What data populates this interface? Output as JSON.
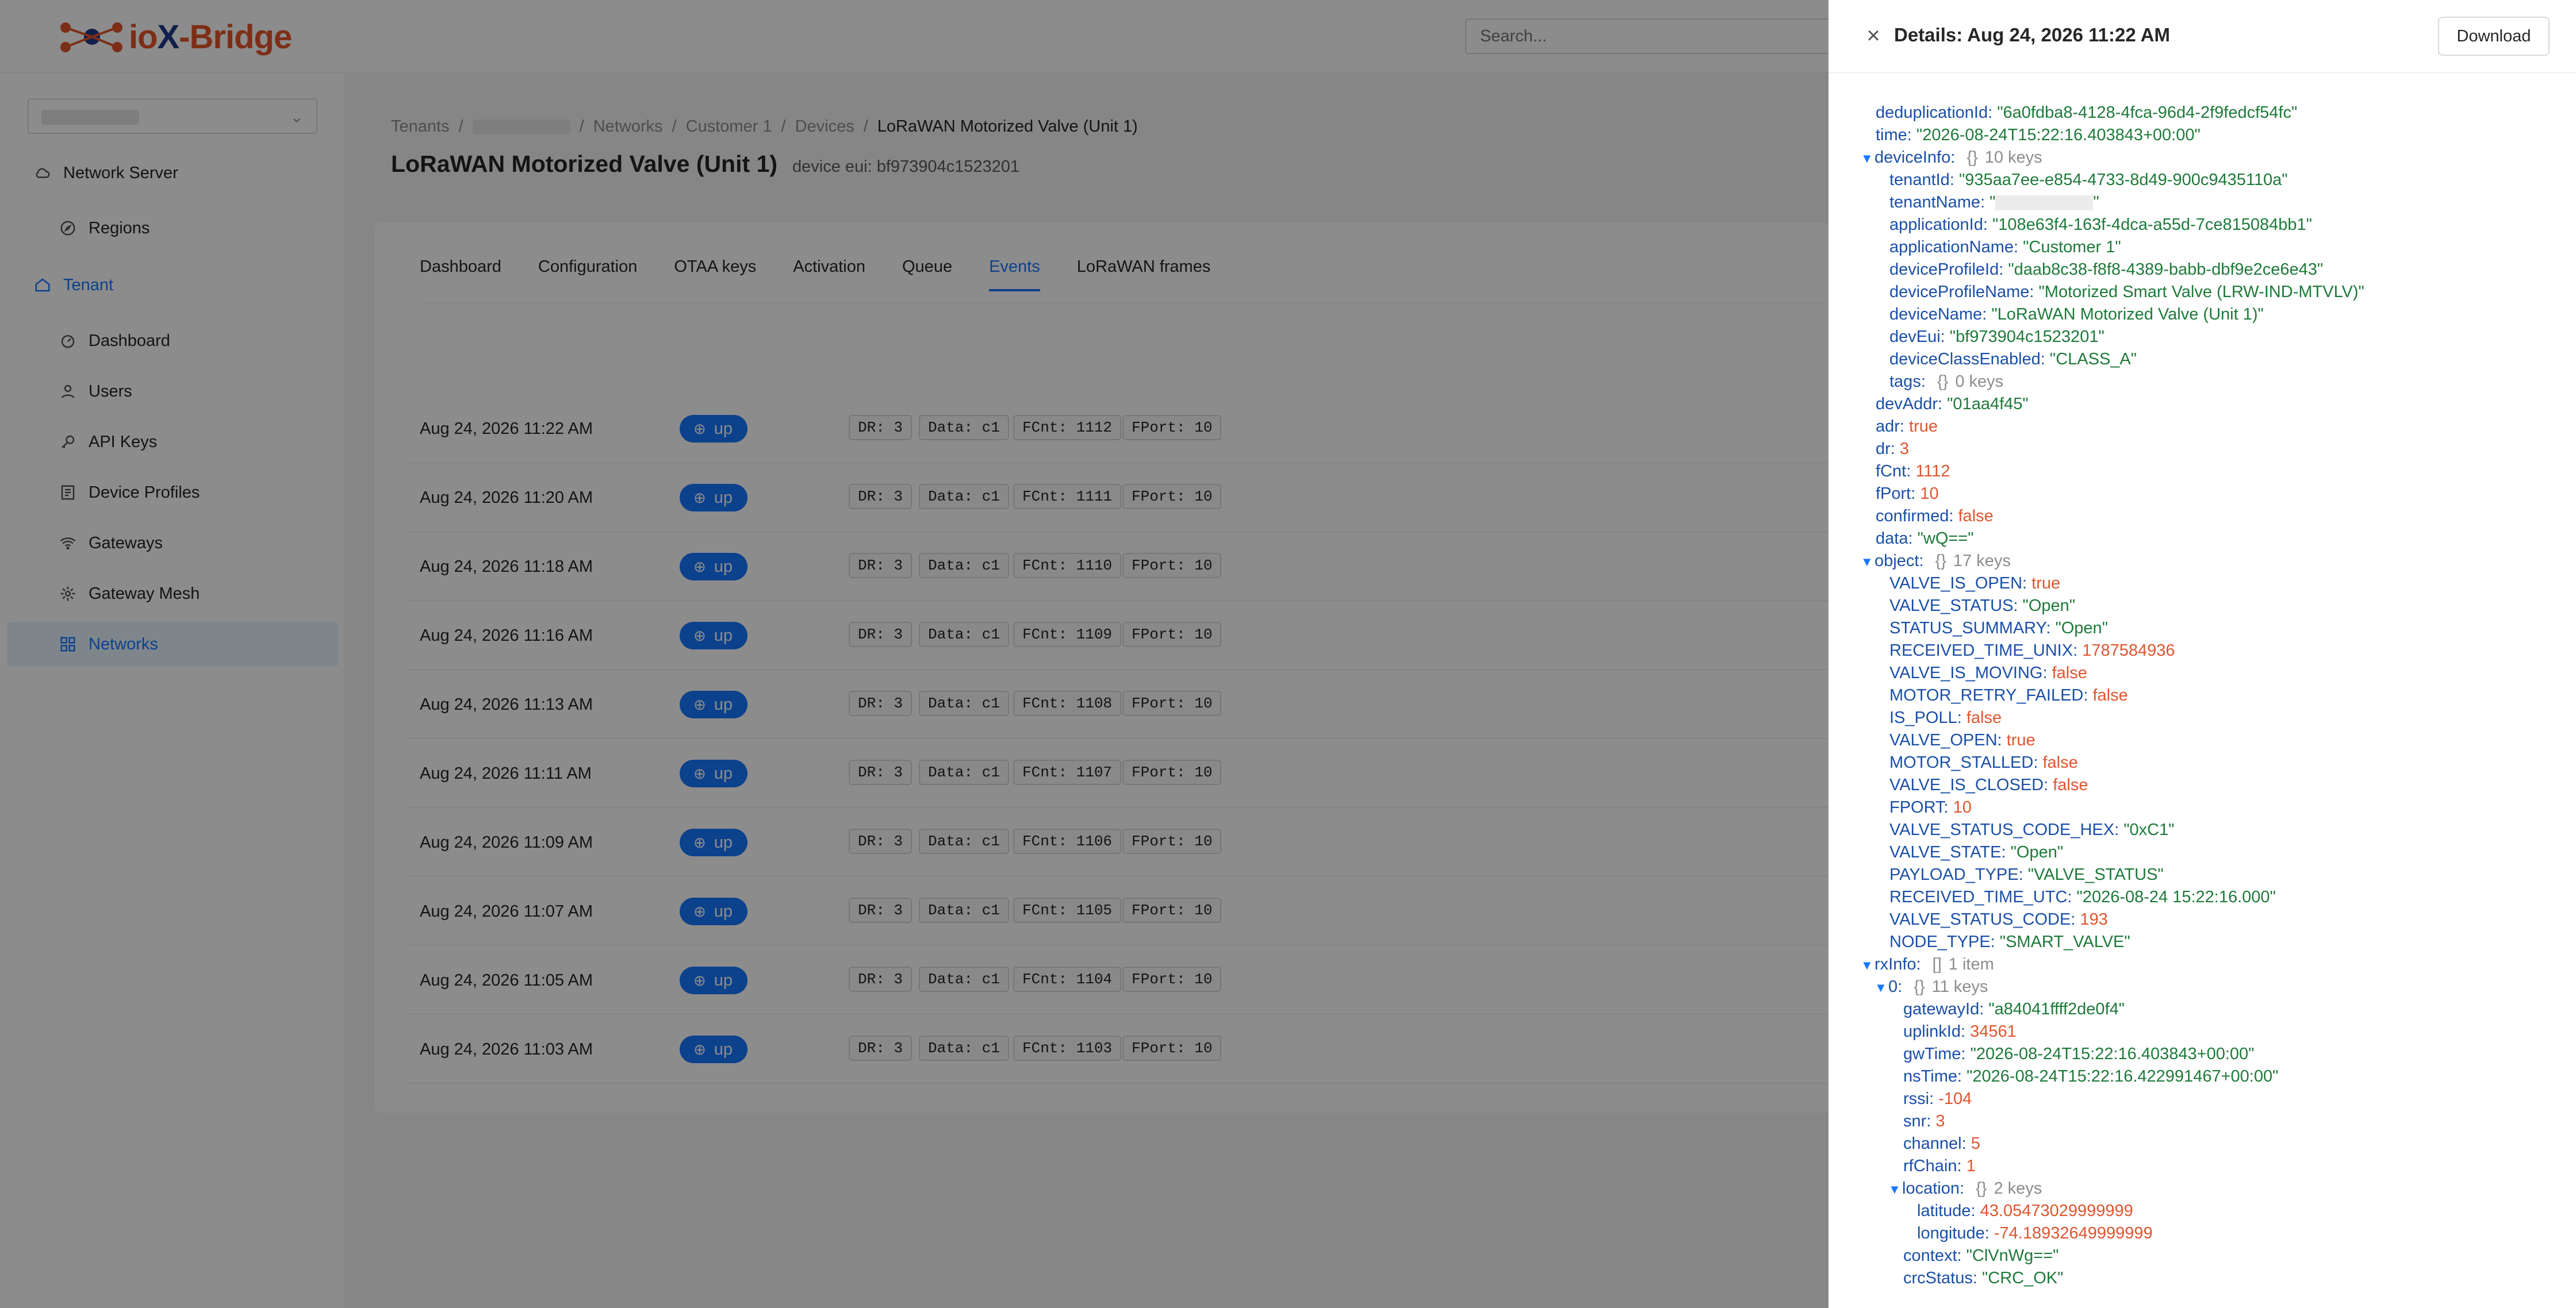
{
  "app": {
    "logo_prefix": "io",
    "logo_x": "X",
    "logo_suffix": "-Bridge",
    "search_placeholder": "Search..."
  },
  "sidebar": {
    "items": [
      {
        "label": "Network Server",
        "icon": "cloud-icon",
        "level": "top"
      },
      {
        "label": "Regions",
        "icon": "compass-icon",
        "level": "sub"
      },
      {
        "label": "Tenant",
        "icon": "home-icon",
        "level": "tenant"
      },
      {
        "label": "Dashboard",
        "icon": "dashboard-icon",
        "level": "sub"
      },
      {
        "label": "Users",
        "icon": "user-icon",
        "level": "sub"
      },
      {
        "label": "API Keys",
        "icon": "key-icon",
        "level": "sub"
      },
      {
        "label": "Device Profiles",
        "icon": "profile-icon",
        "level": "sub"
      },
      {
        "label": "Gateways",
        "icon": "wifi-icon",
        "level": "sub"
      },
      {
        "label": "Gateway Mesh",
        "icon": "mesh-icon",
        "level": "sub"
      },
      {
        "label": "Networks",
        "icon": "grid-icon",
        "level": "sub",
        "active": true
      }
    ]
  },
  "breadcrumb": {
    "tenants": "Tenants",
    "networks": "Networks",
    "customer": "Customer 1",
    "devices": "Devices",
    "current": "LoRaWAN Motorized Valve (Unit 1)"
  },
  "page": {
    "title": "LoRaWAN Motorized Valve (Unit 1)",
    "device_eui": "device eui: bf973904c1523201"
  },
  "tabs": [
    "Dashboard",
    "Configuration",
    "OTAA keys",
    "Activation",
    "Queue",
    "Events",
    "LoRaWAN frames"
  ],
  "active_tab": "Events",
  "events": [
    {
      "time": "Aug 24, 2026 11:22 AM",
      "type": "up",
      "dr": "DR: 3",
      "data": "Data: c1",
      "fcnt": "FCnt: 1112",
      "fport": "FPort: 10"
    },
    {
      "time": "Aug 24, 2026 11:20 AM",
      "type": "up",
      "dr": "DR: 3",
      "data": "Data: c1",
      "fcnt": "FCnt: 1111",
      "fport": "FPort: 10"
    },
    {
      "time": "Aug 24, 2026 11:18 AM",
      "type": "up",
      "dr": "DR: 3",
      "data": "Data: c1",
      "fcnt": "FCnt: 1110",
      "fport": "FPort: 10"
    },
    {
      "time": "Aug 24, 2026 11:16 AM",
      "type": "up",
      "dr": "DR: 3",
      "data": "Data: c1",
      "fcnt": "FCnt: 1109",
      "fport": "FPort: 10"
    },
    {
      "time": "Aug 24, 2026 11:13 AM",
      "type": "up",
      "dr": "DR: 3",
      "data": "Data: c1",
      "fcnt": "FCnt: 1108",
      "fport": "FPort: 10"
    },
    {
      "time": "Aug 24, 2026 11:11 AM",
      "type": "up",
      "dr": "DR: 3",
      "data": "Data: c1",
      "fcnt": "FCnt: 1107",
      "fport": "FPort: 10"
    },
    {
      "time": "Aug 24, 2026 11:09 AM",
      "type": "up",
      "dr": "DR: 3",
      "data": "Data: c1",
      "fcnt": "FCnt: 1106",
      "fport": "FPort: 10"
    },
    {
      "time": "Aug 24, 2026 11:07 AM",
      "type": "up",
      "dr": "DR: 3",
      "data": "Data: c1",
      "fcnt": "FCnt: 1105",
      "fport": "FPort: 10"
    },
    {
      "time": "Aug 24, 2026 11:05 AM",
      "type": "up",
      "dr": "DR: 3",
      "data": "Data: c1",
      "fcnt": "FCnt: 1104",
      "fport": "FPort: 10"
    },
    {
      "time": "Aug 24, 2026 11:03 AM",
      "type": "up",
      "dr": "DR: 3",
      "data": "Data: c1",
      "fcnt": "FCnt: 1103",
      "fport": "FPort: 10"
    }
  ],
  "drawer": {
    "title": "Details: Aug 24, 2026 11:22 AM",
    "download_label": "Download",
    "lines": [
      {
        "d": 0,
        "k": "deduplicationId",
        "v": "\"6a0fdba8-4128-4fca-96d4-2f9fedcf54fc\"",
        "t": "s"
      },
      {
        "d": 0,
        "k": "time",
        "v": "\"2026-08-24T15:22:16.403843+00:00\"",
        "t": "s"
      },
      {
        "d": 0,
        "k": "deviceInfo",
        "v": "{}",
        "t": "m",
        "meta": "10 keys",
        "tri": true
      },
      {
        "d": 1,
        "k": "tenantId",
        "v": "\"935aa7ee-e854-4733-8d49-900c9435110a\"",
        "t": "s"
      },
      {
        "d": 1,
        "k": "tenantName",
        "v": "\"\"",
        "t": "redact"
      },
      {
        "d": 1,
        "k": "applicationId",
        "v": "\"108e63f4-163f-4dca-a55d-7ce815084bb1\"",
        "t": "s"
      },
      {
        "d": 1,
        "k": "applicationName",
        "v": "\"Customer 1\"",
        "t": "s"
      },
      {
        "d": 1,
        "k": "deviceProfileId",
        "v": "\"daab8c38-f8f8-4389-babb-dbf9e2ce6e43\"",
        "t": "s"
      },
      {
        "d": 1,
        "k": "deviceProfileName",
        "v": "\"Motorized Smart Valve (LRW-IND-MTVLV)\"",
        "t": "s"
      },
      {
        "d": 1,
        "k": "deviceName",
        "v": "\"LoRaWAN Motorized Valve (Unit 1)\"",
        "t": "s"
      },
      {
        "d": 1,
        "k": "devEui",
        "v": "\"bf973904c1523201\"",
        "t": "s"
      },
      {
        "d": 1,
        "k": "deviceClassEnabled",
        "v": "\"CLASS_A\"",
        "t": "s"
      },
      {
        "d": 1,
        "k": "tags",
        "v": "{}",
        "t": "m",
        "meta": "0 keys"
      },
      {
        "d": 0,
        "k": "devAddr",
        "v": "\"01aa4f45\"",
        "t": "s"
      },
      {
        "d": 0,
        "k": "adr",
        "v": "true",
        "t": "b"
      },
      {
        "d": 0,
        "k": "dr",
        "v": "3",
        "t": "n"
      },
      {
        "d": 0,
        "k": "fCnt",
        "v": "1112",
        "t": "n"
      },
      {
        "d": 0,
        "k": "fPort",
        "v": "10",
        "t": "n"
      },
      {
        "d": 0,
        "k": "confirmed",
        "v": "false",
        "t": "b"
      },
      {
        "d": 0,
        "k": "data",
        "v": "\"wQ==\"",
        "t": "s"
      },
      {
        "d": 0,
        "k": "object",
        "v": "{}",
        "t": "m",
        "meta": "17 keys",
        "tri": true
      },
      {
        "d": 1,
        "k": "VALVE_IS_OPEN",
        "v": "true",
        "t": "b"
      },
      {
        "d": 1,
        "k": "VALVE_STATUS",
        "v": "\"Open\"",
        "t": "s"
      },
      {
        "d": 1,
        "k": "STATUS_SUMMARY",
        "v": "\"Open\"",
        "t": "s"
      },
      {
        "d": 1,
        "k": "RECEIVED_TIME_UNIX",
        "v": "1787584936",
        "t": "n"
      },
      {
        "d": 1,
        "k": "VALVE_IS_MOVING",
        "v": "false",
        "t": "b"
      },
      {
        "d": 1,
        "k": "MOTOR_RETRY_FAILED",
        "v": "false",
        "t": "b"
      },
      {
        "d": 1,
        "k": "IS_POLL",
        "v": "false",
        "t": "b"
      },
      {
        "d": 1,
        "k": "VALVE_OPEN",
        "v": "true",
        "t": "b"
      },
      {
        "d": 1,
        "k": "MOTOR_STALLED",
        "v": "false",
        "t": "b"
      },
      {
        "d": 1,
        "k": "VALVE_IS_CLOSED",
        "v": "false",
        "t": "b"
      },
      {
        "d": 1,
        "k": "FPORT",
        "v": "10",
        "t": "n"
      },
      {
        "d": 1,
        "k": "VALVE_STATUS_CODE_HEX",
        "v": "\"0xC1\"",
        "t": "s"
      },
      {
        "d": 1,
        "k": "VALVE_STATE",
        "v": "\"Open\"",
        "t": "s"
      },
      {
        "d": 1,
        "k": "PAYLOAD_TYPE",
        "v": "\"VALVE_STATUS\"",
        "t": "s"
      },
      {
        "d": 1,
        "k": "RECEIVED_TIME_UTC",
        "v": "\"2026-08-24 15:22:16.000\"",
        "t": "s"
      },
      {
        "d": 1,
        "k": "VALVE_STATUS_CODE",
        "v": "193",
        "t": "n"
      },
      {
        "d": 1,
        "k": "NODE_TYPE",
        "v": "\"SMART_VALVE\"",
        "t": "s"
      },
      {
        "d": 0,
        "k": "rxInfo",
        "v": "[]",
        "t": "m",
        "meta": "1 item",
        "tri": true
      },
      {
        "d": 1,
        "k": "0",
        "v": "{}",
        "t": "m",
        "meta": "11 keys",
        "tri": true
      },
      {
        "d": 2,
        "k": "gatewayId",
        "v": "\"a84041ffff2de0f4\"",
        "t": "s"
      },
      {
        "d": 2,
        "k": "uplinkId",
        "v": "34561",
        "t": "n"
      },
      {
        "d": 2,
        "k": "gwTime",
        "v": "\"2026-08-24T15:22:16.403843+00:00\"",
        "t": "s"
      },
      {
        "d": 2,
        "k": "nsTime",
        "v": "\"2026-08-24T15:22:16.422991467+00:00\"",
        "t": "s"
      },
      {
        "d": 2,
        "k": "rssi",
        "v": "-104",
        "t": "n"
      },
      {
        "d": 2,
        "k": "snr",
        "v": "3",
        "t": "n"
      },
      {
        "d": 2,
        "k": "channel",
        "v": "5",
        "t": "n"
      },
      {
        "d": 2,
        "k": "rfChain",
        "v": "1",
        "t": "n"
      },
      {
        "d": 2,
        "k": "location",
        "v": "{}",
        "t": "m",
        "meta": "2 keys",
        "tri": true
      },
      {
        "d": 3,
        "k": "latitude",
        "v": "43.05473029999999",
        "t": "n"
      },
      {
        "d": 3,
        "k": "longitude",
        "v": "-74.18932649999999",
        "t": "n"
      },
      {
        "d": 2,
        "k": "context",
        "v": "\"ClVnWg==\"",
        "t": "s"
      },
      {
        "d": 2,
        "k": "crcStatus",
        "v": "\"CRC_OK\"",
        "t": "s"
      }
    ]
  },
  "colors": {
    "primary": "#1677ff",
    "json_key": "#1a4fa8",
    "json_string": "#1e7a3a",
    "json_number": "#e0552f"
  }
}
